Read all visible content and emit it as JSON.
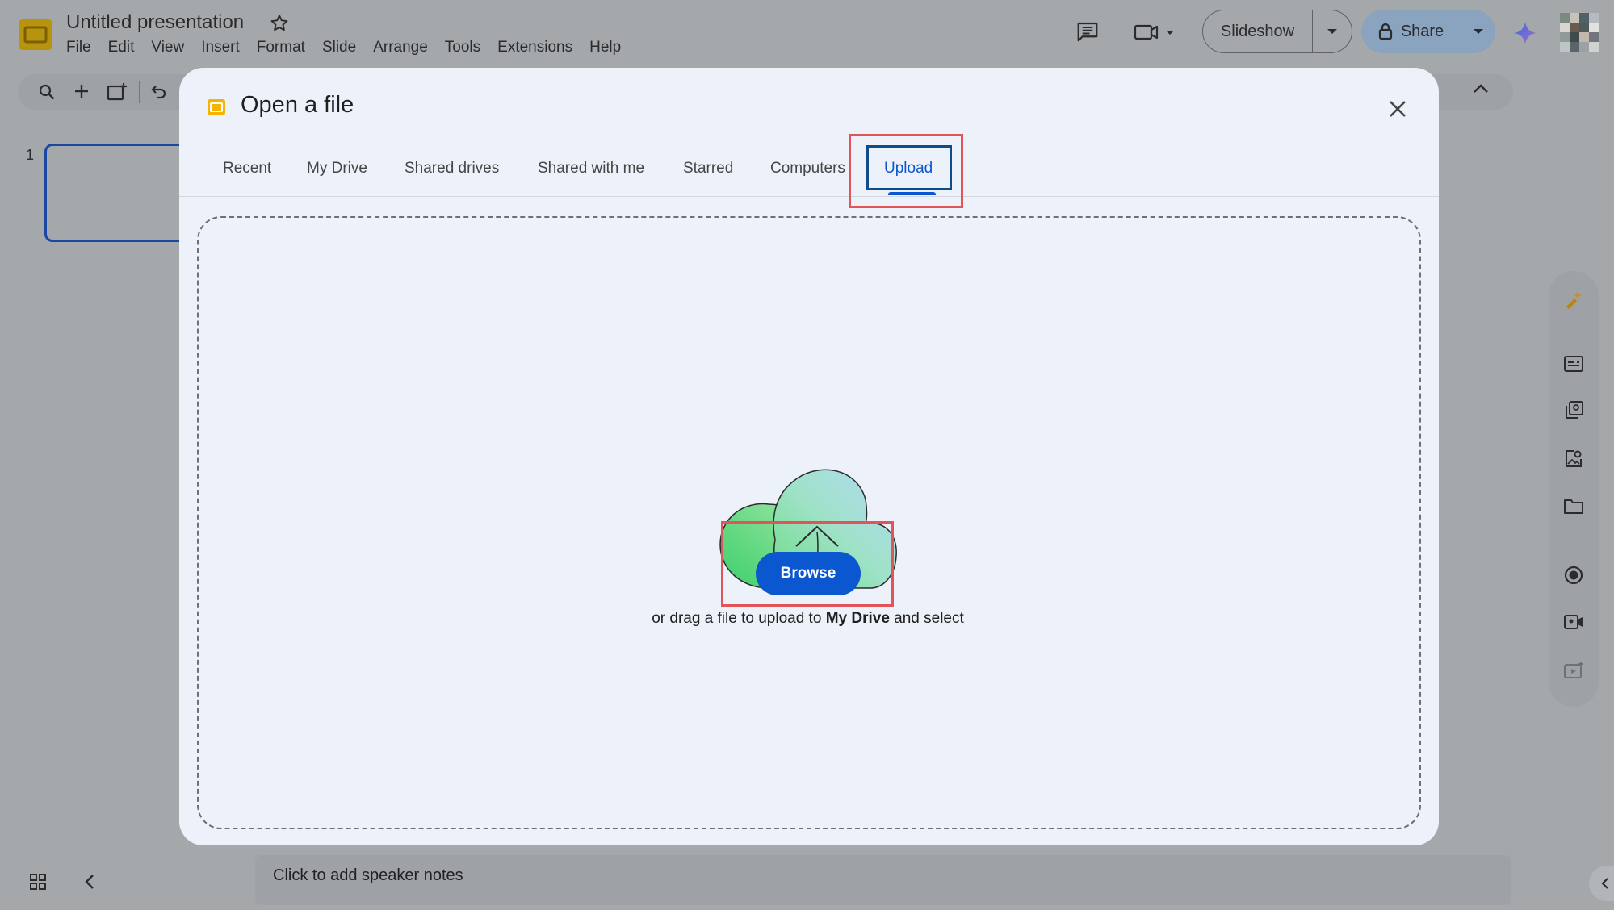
{
  "app": {
    "doc_title": "Untitled presentation",
    "menu": [
      "File",
      "Edit",
      "View",
      "Insert",
      "Format",
      "Slide",
      "Arrange",
      "Tools",
      "Extensions",
      "Help"
    ],
    "slideshow_label": "Slideshow",
    "share_label": "Share",
    "slide_number": "1",
    "speaker_notes_placeholder": "Click to add speaker notes"
  },
  "dialog": {
    "title": "Open a file",
    "tabs": [
      {
        "label": "Recent"
      },
      {
        "label": "My Drive"
      },
      {
        "label": "Shared drives"
      },
      {
        "label": "Shared with me"
      },
      {
        "label": "Starred"
      },
      {
        "label": "Computers"
      },
      {
        "label": "Upload",
        "active": true
      }
    ],
    "browse_label": "Browse",
    "hint_prefix": "or drag a file to upload to ",
    "hint_location": "My Drive",
    "hint_suffix": " and select"
  },
  "colors": {
    "accent": "#0b57d0",
    "annotation": "#e0545a",
    "dialog_bg": "#edf1f9",
    "backdrop": "#a5a8ab"
  },
  "icons": {
    "logo": "slides-logo-icon",
    "star": "star-icon",
    "close": "close-icon",
    "cloud": "cloud-upload-icon"
  }
}
